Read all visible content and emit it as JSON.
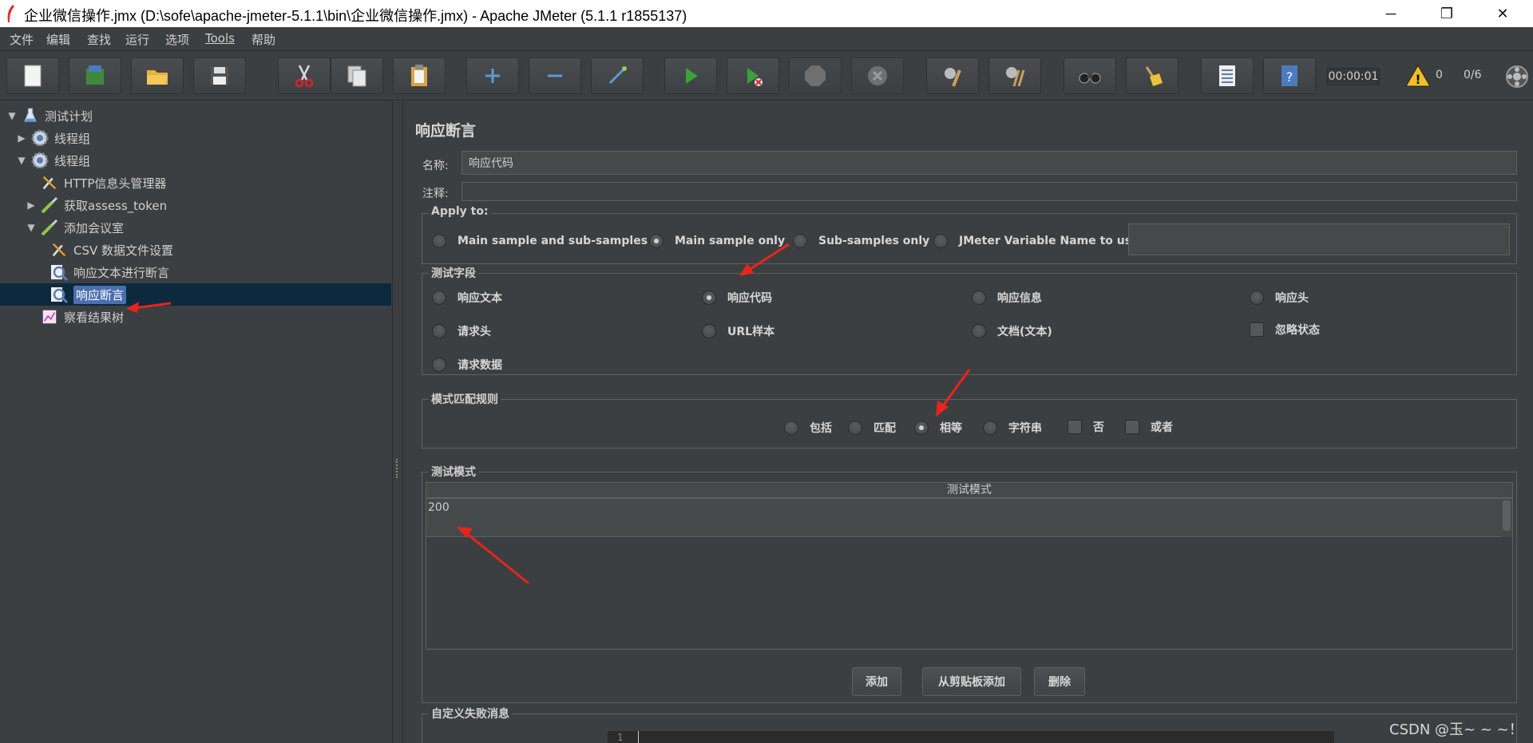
{
  "window": {
    "title": "企业微信操作.jmx (D:\\sofe\\apache-jmeter-5.1.1\\bin\\企业微信操作.jmx) - Apache JMeter (5.1.1 r1855137)",
    "minimize": "─",
    "restore": "❐",
    "close": "✕"
  },
  "menu": [
    "文件",
    "编辑",
    "查找",
    "运行",
    "选项",
    "Tools",
    "帮助"
  ],
  "toolbar": {
    "timer": "00:00:01",
    "warn_count": "0",
    "threads": "0/6"
  },
  "tree": [
    {
      "label": "测试计划",
      "indent": 0,
      "toggle": "▼",
      "icon": "flask-icon"
    },
    {
      "label": "线程组",
      "indent": 1,
      "toggle": "▶",
      "icon": "gear-icon"
    },
    {
      "label": "线程组",
      "indent": 1,
      "toggle": "▼",
      "icon": "gear-icon"
    },
    {
      "label": "HTTP信息头管理器",
      "indent": 2,
      "toggle": "",
      "icon": "wrench-icon"
    },
    {
      "label": "获取assess_token",
      "indent": 2,
      "toggle": "▶",
      "icon": "pipette-icon"
    },
    {
      "label": "添加会议室",
      "indent": 2,
      "toggle": "▼",
      "icon": "pipette-icon"
    },
    {
      "label": "CSV 数据文件设置",
      "indent": 3,
      "toggle": "",
      "icon": "wrench-icon"
    },
    {
      "label": "响应文本进行断言",
      "indent": 3,
      "toggle": "",
      "icon": "magnifier-icon"
    },
    {
      "label": "响应断言",
      "indent": 3,
      "toggle": "",
      "icon": "magnifier-icon",
      "selected": true
    },
    {
      "label": "察看结果树",
      "indent": 2,
      "toggle": "",
      "icon": "chart-icon"
    }
  ],
  "panel": {
    "title": "响应断言",
    "name_label": "名称:",
    "name_value": "响应代码",
    "comment_label": "注释:",
    "comment_value": "",
    "apply_to": {
      "legend": "Apply to:",
      "options": [
        "Main sample and sub-samples",
        "Main sample only",
        "Sub-samples only",
        "JMeter Variable Name to use"
      ],
      "selected": "Main sample only",
      "variable_value": ""
    },
    "test_field": {
      "legend": "测试字段",
      "options": [
        "响应文本",
        "响应代码",
        "响应信息",
        "响应头",
        "请求头",
        "URL样本",
        "文档(文本)",
        "请求数据"
      ],
      "selected": "响应代码",
      "ignore_status": "忽略状态"
    },
    "match_rules": {
      "legend": "模式匹配规则",
      "options": [
        "包括",
        "匹配",
        "相等",
        "字符串"
      ],
      "selected": "相等",
      "checks": [
        "否",
        "或者"
      ]
    },
    "patterns": {
      "legend": "测试模式",
      "column_header": "测试模式",
      "rows": [
        "200"
      ],
      "add": "添加",
      "add_clipboard": "从剪贴板添加",
      "delete": "删除"
    },
    "custom_failure": {
      "legend": "自定义失败消息",
      "line_number": "1"
    }
  },
  "watermark": "CSDN @玉~ ~ ~！"
}
